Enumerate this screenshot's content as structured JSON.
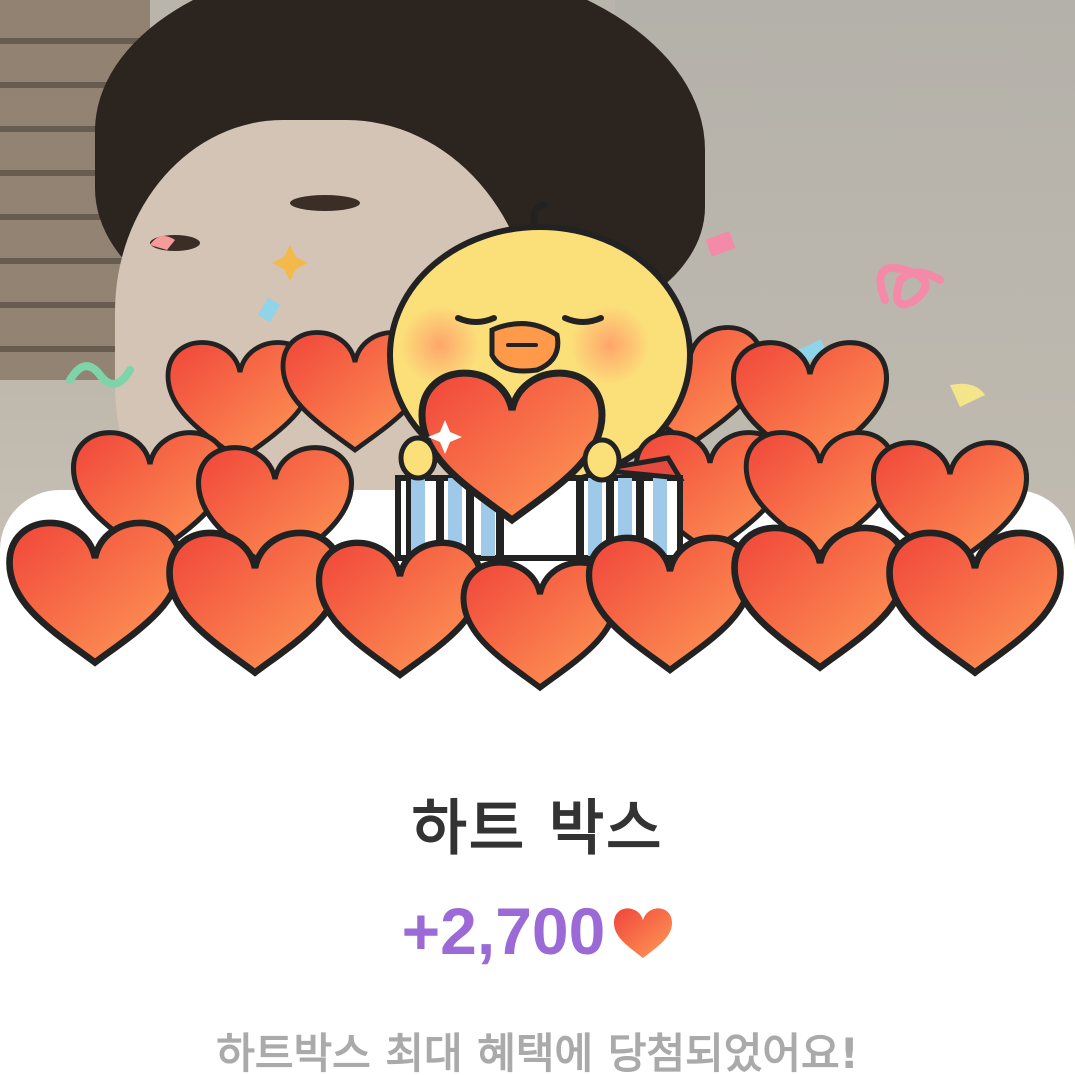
{
  "reward": {
    "title": "하트 박스",
    "amount": "+2,700",
    "currency_icon": "heart-icon",
    "message": "하트박스 최대 혜택에 당첨되었어요!"
  },
  "colors": {
    "amount": "#9b6ad6",
    "title": "#333333",
    "message": "#aaaaaa",
    "heart_dark": "#f04a3c",
    "heart_light": "#ff9a55",
    "chick": "#fbe07a"
  }
}
